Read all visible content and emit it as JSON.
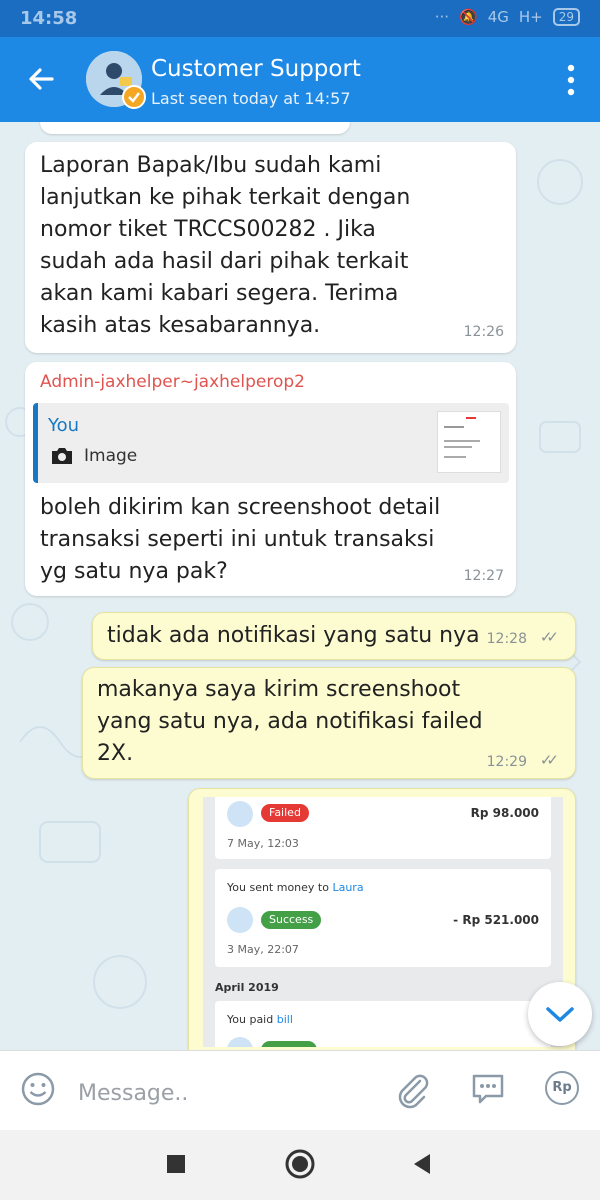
{
  "status_bar": {
    "time": "14:58",
    "network": "4G",
    "network2": "H+",
    "battery": "29"
  },
  "header": {
    "title": "Customer Support",
    "subtitle": "Last seen today at 14:57"
  },
  "messages": [
    {
      "text": "Laporan Bapak/Ibu sudah kami lanjutkan ke pihak terkait dengan nomor tiket TRCCS00282 . Jika sudah hasil dari pihak terkait akan kami kabari segera. Terima kasih atas kesabarannya.",
      "lines": [
        "Laporan Bapak/Ibu sudah kami",
        "lanjutkan ke pihak terkait dengan",
        "nomor tiket TRCCS00282 . Jika",
        "sudah ada hasil dari pihak terkait",
        "akan kami kabari segera. Terima",
        "kasih atas kesabarannya."
      ],
      "time": "12:26"
    },
    {
      "sender": "Admin-jaxhelper~jaxhelperop2",
      "reply_to": {
        "author": "You",
        "type_label": "Image"
      },
      "lines": [
        "boleh dikirim kan screenshoot detail",
        "transaksi seperti ini untuk transaksi",
        "yg satu nya pak?"
      ],
      "time": "12:27"
    },
    {
      "lines": [
        "tidak ada notifikasi yang satu nya"
      ],
      "time": "12:28"
    },
    {
      "lines": [
        "makanya saya kirim screenshoot",
        "yang satu nya, ada notifikasi failed",
        "2X."
      ],
      "time": "12:29"
    }
  ],
  "screenshot": {
    "tx1": {
      "status": "Failed",
      "amount": "Rp 98.000",
      "date": "7 May, 12:03"
    },
    "tx2": {
      "title_prefix": "You sent money to ",
      "recipient": "Laura",
      "status": "Success",
      "amount": "- Rp 521.000",
      "date": "3 May, 22:07"
    },
    "section": "April 2019",
    "tx3": {
      "title_prefix": "You paid ",
      "target": "bill"
    }
  },
  "composer": {
    "placeholder": "Message.."
  },
  "colors": {
    "header": "#1e88e5",
    "status_bar": "#1a6dc1",
    "failed": "#e53935",
    "success": "#43a047"
  }
}
